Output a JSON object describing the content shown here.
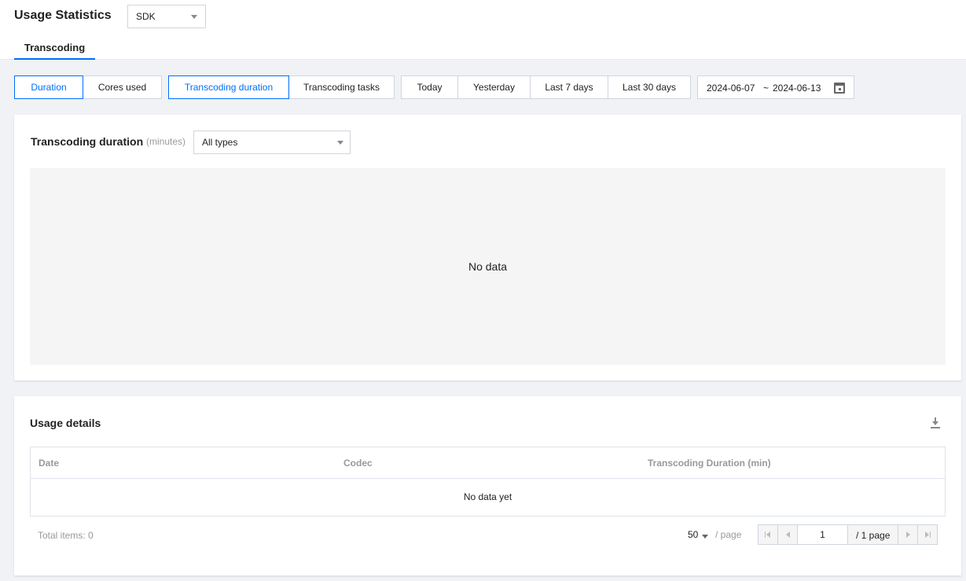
{
  "header": {
    "title": "Usage Statistics",
    "product_select": "SDK",
    "tab": "Transcoding"
  },
  "filters": {
    "metric_group": [
      "Duration",
      "Cores used"
    ],
    "metric_active": 0,
    "type_group": [
      "Transcoding duration",
      "Transcoding tasks"
    ],
    "type_active": 0,
    "range_group": [
      "Today",
      "Yesterday",
      "Last 7 days",
      "Last 30 days"
    ],
    "date_start": "2024-06-07",
    "date_sep": "~",
    "date_end": "2024-06-13"
  },
  "chart": {
    "title": "Transcoding duration",
    "unit": "(minutes)",
    "type_select": "All types",
    "empty_text": "No data"
  },
  "details": {
    "title": "Usage details",
    "columns": [
      "Date",
      "Codec",
      "Transcoding Duration (min)"
    ],
    "rows": [],
    "empty_text": "No data yet",
    "total_label": "Total items:",
    "total_count": "0",
    "page_size": "50",
    "per_page_label": "/ page",
    "current_page": "1",
    "page_total": "/ 1 page"
  },
  "colors": {
    "accent": "#006eff",
    "background": "#f1f2f6",
    "border": "#cfd5de"
  }
}
